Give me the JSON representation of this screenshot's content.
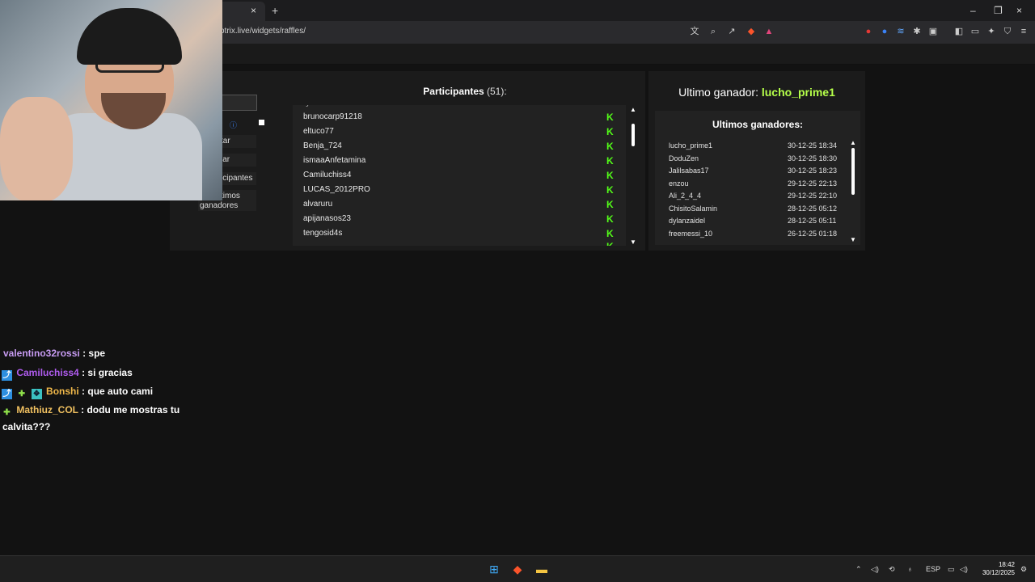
{
  "browser": {
    "tab_close": "×",
    "new_tab": "+",
    "url": "otrix.live/widgets/raffles/",
    "window_controls": [
      "–",
      "❐",
      "×"
    ]
  },
  "left_buttons": {
    "b1": "tar",
    "b2": "iar",
    "b3": "icipantes",
    "b4_line1": "timos",
    "b4_line2": "ganadores"
  },
  "participants": {
    "title": "Participantes",
    "count": "(51):",
    "items": [
      "brunocarp91218",
      "eltuco77",
      "Benja_724",
      "ismaaAnfetamina",
      "Camiluchiss4",
      "LUCAS_2012PRO",
      "alvaruru",
      "apijanasos23",
      "tengosid4s"
    ]
  },
  "last_winner": {
    "label": "Ultimo ganador:",
    "name": "lucho_prime1"
  },
  "winners": {
    "title": "Ultimos ganadores:",
    "items": [
      {
        "name": "lucho_prime1",
        "date": "30-12-25 18:34"
      },
      {
        "name": "DoduZen",
        "date": "30-12-25 18:30"
      },
      {
        "name": "Jalilsabas17",
        "date": "30-12-25 18:23"
      },
      {
        "name": "enzou",
        "date": "29-12-25 22:13"
      },
      {
        "name": "Ali_2_4_4",
        "date": "29-12-25 22:10"
      },
      {
        "name": "ChisitoSalamin",
        "date": "28-12-25 05:12"
      },
      {
        "name": "dylanzaidel",
        "date": "28-12-25 05:11"
      },
      {
        "name": "freemessi_10",
        "date": "26-12-25 01:18"
      }
    ]
  },
  "chat": [
    {
      "user": "valentino32rossi",
      "color": "#c79bf2",
      "msg": ": spe"
    },
    {
      "user": "Camiluchiss4",
      "color": "#b05cf0",
      "msg": ": si gracias"
    },
    {
      "user": "Bonshi",
      "color": "#f0b84a",
      "msg": ": que auto cami"
    },
    {
      "user": "Mathiuz_COL",
      "color": "#f0c060",
      "msg": ": dodu me mostras tu",
      "msg2": "calvita???"
    }
  ],
  "taskbar": {
    "lang": "ESP",
    "time": "18:42",
    "date": "30/12/2025"
  },
  "colors": {
    "kick_green": "#53fc18",
    "winner_green": "#b5ff4a"
  }
}
